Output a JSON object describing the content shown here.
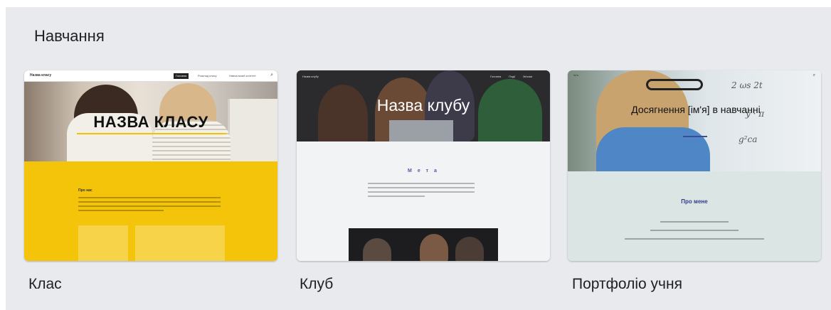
{
  "section": {
    "title": "Навчання"
  },
  "templates": [
    {
      "label": "Клас",
      "preview": {
        "site_name": "Назва класу",
        "nav": [
          "Головна",
          "Розклад класу",
          "Навчальний контент"
        ],
        "hero_title": "НАЗВА КЛАСУ",
        "section_heading": "Про нас",
        "accent_color": "#f4c40b"
      }
    },
    {
      "label": "Клуб",
      "preview": {
        "site_name": "Назва клубу",
        "nav": [
          "Головна",
          "Події",
          "Зв'язки"
        ],
        "hero_title": "Назва клубу",
        "section_heading": "М е т а",
        "accent_color": "#6a4fa1"
      }
    },
    {
      "label": "Портфоліо учня",
      "preview": {
        "site_name": "Ім'я",
        "hero_title": "Досягнення [ім'я] в навчанні",
        "section_heading": "Про мене",
        "accent_color": "#2f3e8a"
      }
    }
  ]
}
